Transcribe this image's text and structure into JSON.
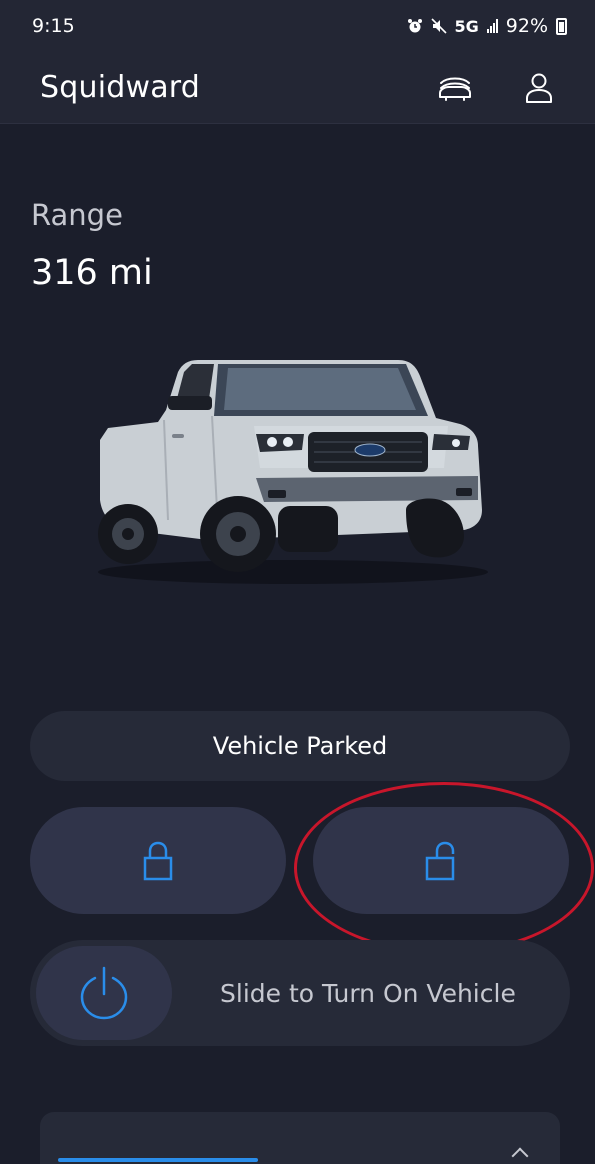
{
  "status_bar": {
    "time": "9:15",
    "network": "5G",
    "battery": "92%",
    "icons": [
      "alarm-icon",
      "mute-icon",
      "signal-icon",
      "battery-icon"
    ]
  },
  "header": {
    "title": "Squidward",
    "icons": [
      "vehicle-switcher-icon",
      "account-icon"
    ]
  },
  "range": {
    "label": "Range",
    "value": "316 mi"
  },
  "vehicle": {
    "status": "Vehicle Parked"
  },
  "controls": {
    "lock_icon": "lock-icon",
    "unlock_icon": "unlock-icon",
    "power_icon": "power-icon",
    "slide_label": "Slide to Turn On Vehicle"
  },
  "colors": {
    "background": "#1b1e2b",
    "header": "#232634",
    "accent": "#2a8dea",
    "highlight_ring": "#c8162b"
  }
}
